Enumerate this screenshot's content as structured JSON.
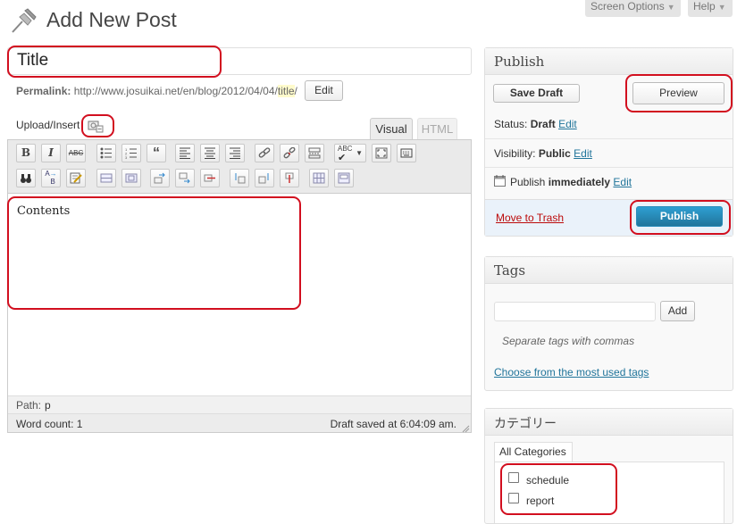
{
  "header": {
    "title": "Add New Post",
    "screen_options": "Screen Options",
    "help": "Help"
  },
  "post": {
    "title_value": "Title",
    "permalink_label": "Permalink:",
    "permalink_base": "http://www.josuikai.net/en/blog/2012/04/04/",
    "permalink_slug": "title",
    "permalink_end": "/",
    "permalink_edit": "Edit"
  },
  "editor": {
    "upload_insert": "Upload/Insert",
    "tab_visual": "Visual",
    "tab_html": "HTML",
    "content": "Contents",
    "path_label": "Path:",
    "path_value": "p",
    "word_count": "Word count: 1",
    "draft_saved": "Draft saved at 6:04:09 am."
  },
  "publish": {
    "title": "Publish",
    "save_draft": "Save Draft",
    "preview": "Preview",
    "status_label": "Status:",
    "status_value": "Draft",
    "visibility_label": "Visibility:",
    "visibility_value": "Public",
    "publish_label": "Publish",
    "publish_value": "immediately",
    "edit": "Edit",
    "move_to_trash": "Move to Trash",
    "publish_button": "Publish"
  },
  "tags": {
    "title": "Tags",
    "input_value": "",
    "add": "Add",
    "hint": "Separate tags with commas",
    "choose": "Choose from the most used tags"
  },
  "categories": {
    "title": "カテゴリー",
    "tab_all": "All Categories",
    "items": [
      "schedule",
      "report"
    ]
  },
  "colors": {
    "annotation": "#d20f1f",
    "link": "#21759b",
    "publish_button": "#21759b",
    "trash": "#bc0b0b"
  }
}
